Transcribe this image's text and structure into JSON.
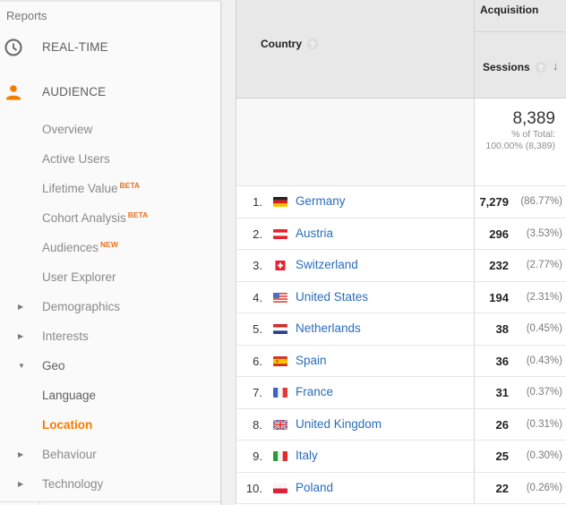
{
  "sidebar": {
    "heading": "Reports",
    "sections": [
      {
        "label": "REAL-TIME",
        "icon": "clock-icon"
      },
      {
        "label": "AUDIENCE",
        "icon": "person-icon",
        "color": "#f57c00"
      }
    ],
    "items": [
      {
        "label": "Overview"
      },
      {
        "label": "Active Users"
      },
      {
        "label": "Lifetime Value",
        "badge": "BETA"
      },
      {
        "label": "Cohort Analysis",
        "badge": "BETA"
      },
      {
        "label": "Audiences",
        "badge": "NEW"
      },
      {
        "label": "User Explorer"
      },
      {
        "label": "Demographics",
        "arrow": "collapsed"
      },
      {
        "label": "Interests",
        "arrow": "collapsed"
      },
      {
        "label": "Geo",
        "arrow": "expanded"
      },
      {
        "label": "Language"
      },
      {
        "label": "Location",
        "active": true
      },
      {
        "label": "Behaviour",
        "arrow": "collapsed"
      },
      {
        "label": "Technology",
        "arrow": "collapsed"
      }
    ],
    "accent_color": "#f57c00",
    "badge_color": "#e8711c"
  },
  "table": {
    "headers": {
      "country": "Country",
      "group": "Acquisition",
      "sessions": "Sessions",
      "help_glyph": "?",
      "sort_glyph": "↓"
    },
    "total": {
      "value": "8,389",
      "pct_label": "% of Total:",
      "pct_value": "100.00% (8,389)"
    },
    "rows": [
      {
        "index": "1.",
        "country": "Germany",
        "flag": "de",
        "sessions": "7,279",
        "pct": "(86.77%)"
      },
      {
        "index": "2.",
        "country": "Austria",
        "flag": "at",
        "sessions": "296",
        "pct": "(3.53%)"
      },
      {
        "index": "3.",
        "country": "Switzerland",
        "flag": "ch",
        "sessions": "232",
        "pct": "(2.77%)"
      },
      {
        "index": "4.",
        "country": "United States",
        "flag": "us",
        "sessions": "194",
        "pct": "(2.31%)"
      },
      {
        "index": "5.",
        "country": "Netherlands",
        "flag": "nl",
        "sessions": "38",
        "pct": "(0.45%)"
      },
      {
        "index": "6.",
        "country": "Spain",
        "flag": "es",
        "sessions": "36",
        "pct": "(0.43%)"
      },
      {
        "index": "7.",
        "country": "France",
        "flag": "fr",
        "sessions": "31",
        "pct": "(0.37%)"
      },
      {
        "index": "8.",
        "country": "United Kingdom",
        "flag": "gb",
        "sessions": "26",
        "pct": "(0.31%)"
      },
      {
        "index": "9.",
        "country": "Italy",
        "flag": "it",
        "sessions": "25",
        "pct": "(0.30%)"
      },
      {
        "index": "10.",
        "country": "Poland",
        "flag": "pl",
        "sessions": "22",
        "pct": "(0.26%)"
      }
    ],
    "link_color": "#2a6dbb"
  }
}
